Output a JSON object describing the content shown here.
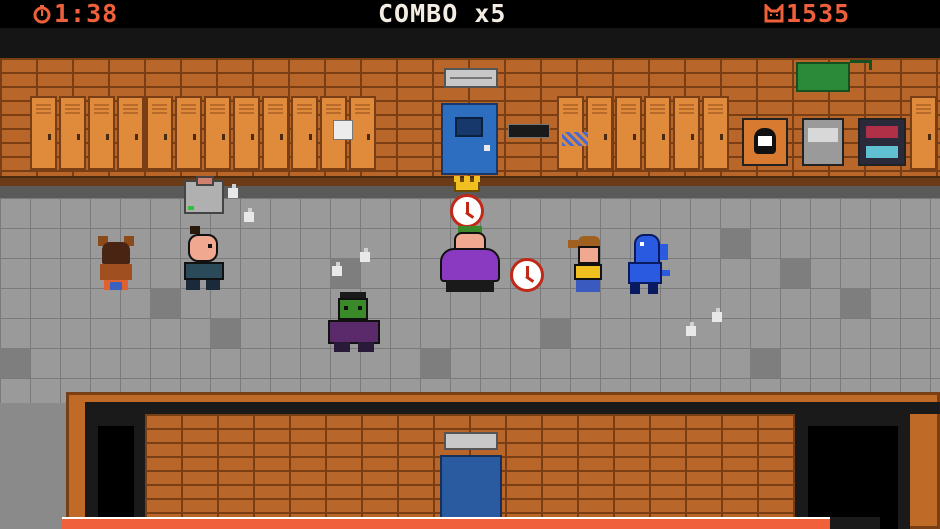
{
  "hud": {
    "timer_icon": "stopwatch-icon",
    "timer": "1:38",
    "combo_label": "COMBO",
    "combo_multiplier": "x5",
    "score_icon": "cat-face-icon",
    "score": "1535"
  },
  "colors": {
    "hud_accent": "#f0603a",
    "hud_text": "#f2ece2",
    "brick": "#b8662a",
    "locker": "#e08a3c",
    "door": "#2e6ec0",
    "floor": "#9a9a9a"
  },
  "scene": {
    "characters": [
      {
        "name": "kid-back-view",
        "icon": "kid-icon"
      },
      {
        "name": "bald-kid",
        "icon": "kid-icon"
      },
      {
        "name": "trash-can",
        "icon": "trash-can-icon"
      },
      {
        "name": "crown-kid",
        "icon": "crown-icon"
      },
      {
        "name": "purple-teacher",
        "icon": "teacher-icon"
      },
      {
        "name": "ponytail-girl",
        "icon": "kid-icon"
      },
      {
        "name": "blue-dino",
        "icon": "dino-icon"
      },
      {
        "name": "frankenstein-kid",
        "icon": "monster-icon"
      }
    ],
    "pickups": [
      {
        "name": "clock-pickup",
        "icon": "clock-icon"
      },
      {
        "name": "clock-pickup",
        "icon": "clock-icon"
      }
    ]
  }
}
